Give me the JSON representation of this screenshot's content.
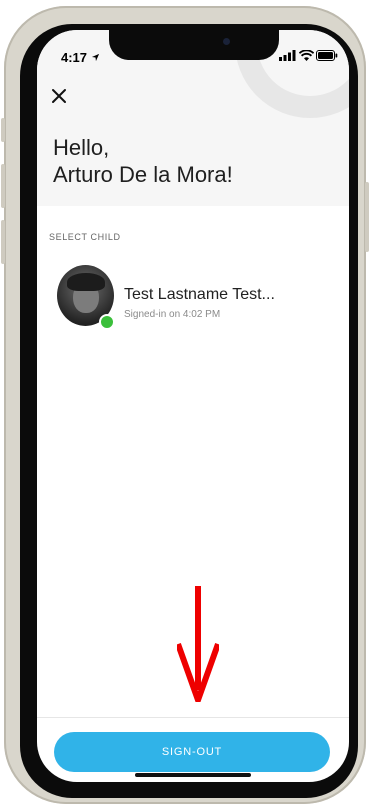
{
  "status_bar": {
    "time": "4:17"
  },
  "header": {
    "greeting_line1": "Hello,",
    "greeting_line2": "Arturo De la Mora!"
  },
  "section": {
    "label": "SELECT CHILD"
  },
  "children": [
    {
      "name": "Test Lastname Test...",
      "status": "Signed-in on 4:02 PM",
      "online": true
    }
  ],
  "footer": {
    "signout_label": "SIGN-OUT"
  },
  "colors": {
    "accent": "#30b3e8",
    "online": "#3bbf3b",
    "arrow": "#ee0000",
    "frame": "#d9d6cc"
  },
  "icons": [
    "location-arrow-icon",
    "signal-icon",
    "wifi-icon",
    "battery-icon",
    "close-icon",
    "down-arrow-icon"
  ]
}
